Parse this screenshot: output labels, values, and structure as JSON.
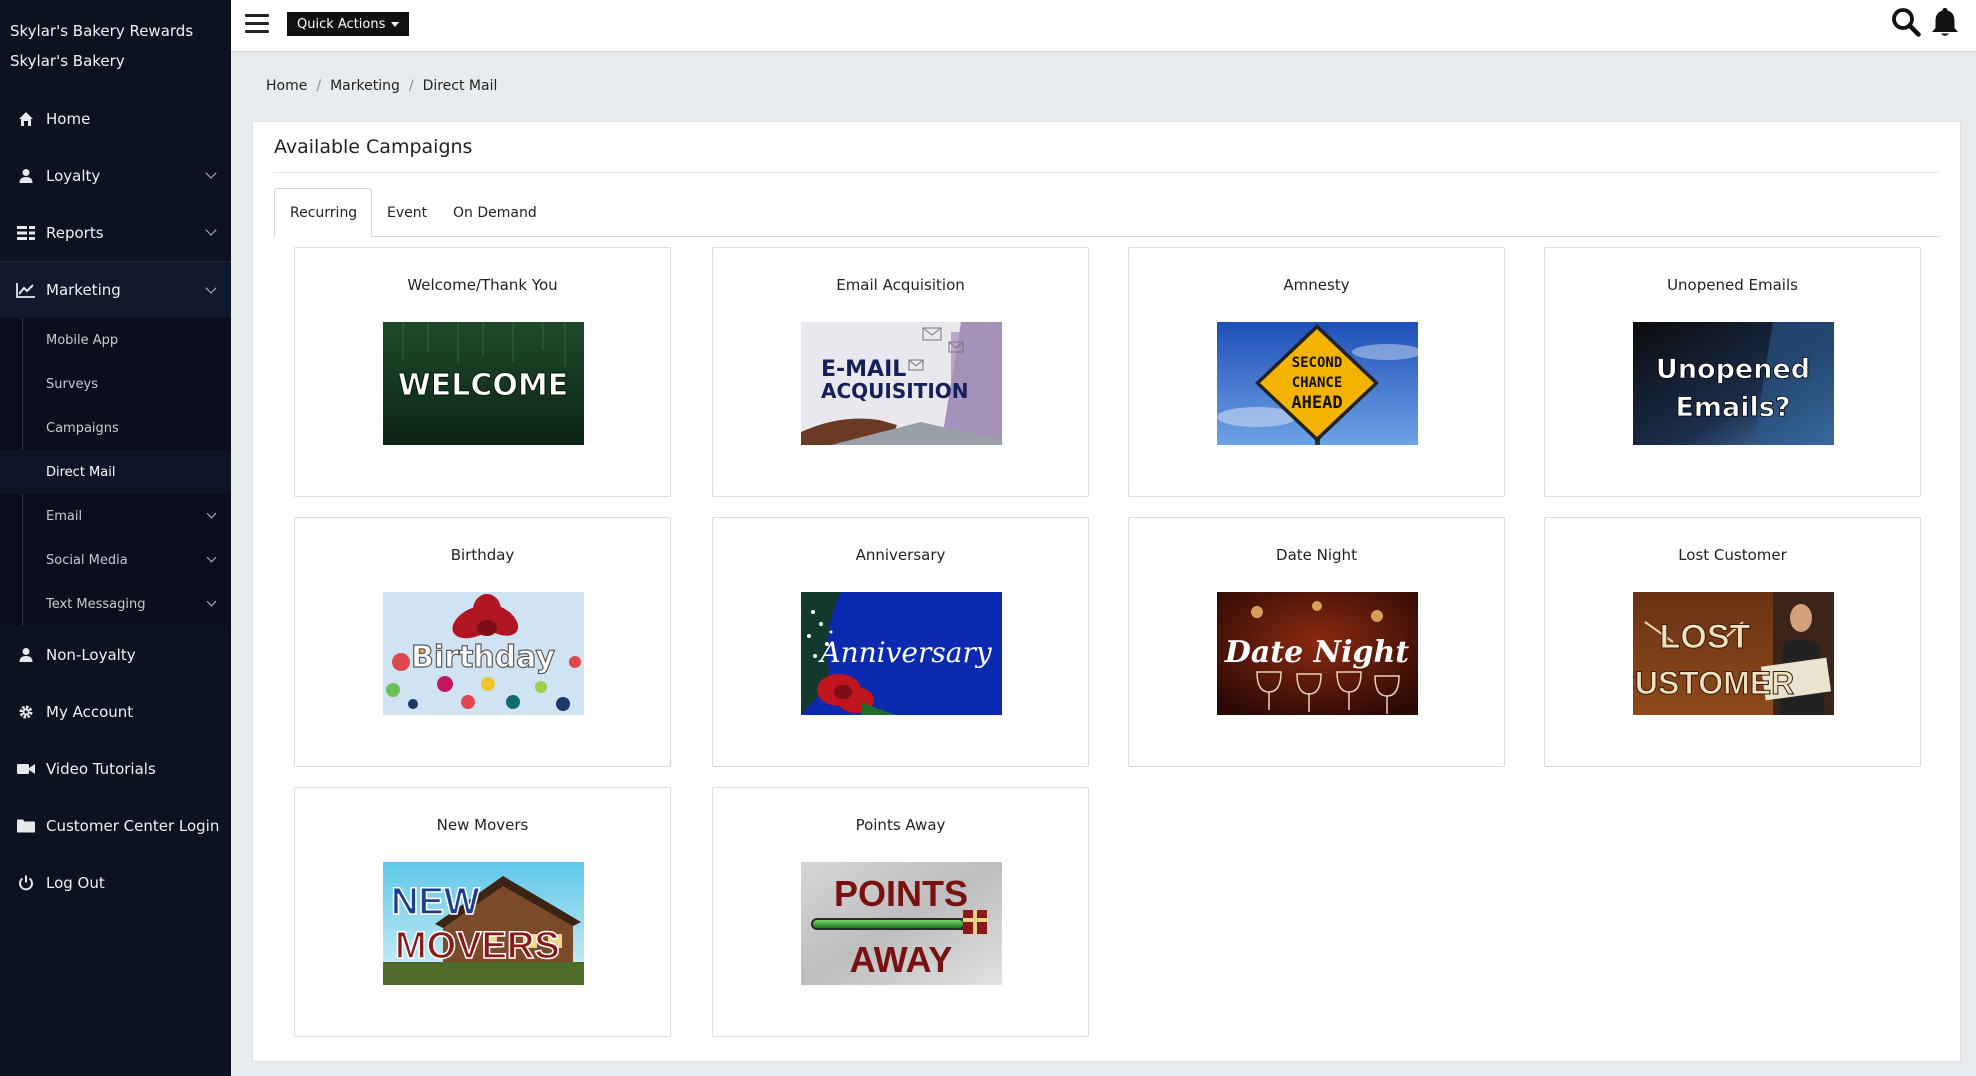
{
  "brand": {
    "program": "Skylar's Bakery Rewards",
    "business": "Skylar's Bakery"
  },
  "topbar": {
    "quick_actions_label": "Quick Actions"
  },
  "sidebar": {
    "items": [
      {
        "label": "Home",
        "icon": "home-icon"
      },
      {
        "label": "Loyalty",
        "icon": "user-icon"
      },
      {
        "label": "Reports",
        "icon": "reports-icon"
      },
      {
        "label": "Marketing",
        "icon": "chart-icon"
      },
      {
        "label": "Non-Loyalty",
        "icon": "user-icon"
      },
      {
        "label": "My Account",
        "icon": "gear-icon"
      },
      {
        "label": "Video Tutorials",
        "icon": "video-icon"
      },
      {
        "label": "Customer Center Login",
        "icon": "folder-icon"
      },
      {
        "label": "Log Out",
        "icon": "power-icon"
      }
    ],
    "marketing_sub": [
      "Mobile App",
      "Surveys",
      "Campaigns",
      "Direct Mail",
      "Email",
      "Social Media",
      "Text Messaging"
    ],
    "active_sub": "Direct Mail"
  },
  "breadcrumb": [
    "Home",
    "Marketing",
    "Direct Mail"
  ],
  "panel": {
    "title": "Available Campaigns"
  },
  "tabs": [
    "Recurring",
    "Event",
    "On Demand"
  ],
  "active_tab": "Recurring",
  "campaigns": [
    {
      "title": "Welcome/Thank You",
      "image_text": [
        "WELCOME"
      ]
    },
    {
      "title": "Email Acquisition",
      "image_text": [
        "E-MAIL",
        "ACQUISITION"
      ]
    },
    {
      "title": "Amnesty",
      "image_text": [
        "SECOND",
        "CHANCE",
        "AHEAD"
      ]
    },
    {
      "title": "Unopened Emails",
      "image_text": [
        "Unopened",
        "Emails?"
      ]
    },
    {
      "title": "Birthday",
      "image_text": [
        "Birthday"
      ]
    },
    {
      "title": "Anniversary",
      "image_text": [
        "Anniversary"
      ]
    },
    {
      "title": "Date Night",
      "image_text": [
        "Date Night"
      ]
    },
    {
      "title": "Lost Customer",
      "image_text": [
        "LOST",
        "CUSTOMER"
      ]
    },
    {
      "title": "New Movers",
      "image_text": [
        "NEW",
        "MOVERS"
      ]
    },
    {
      "title": "Points Away",
      "image_text": [
        "POINTS",
        "AWAY"
      ]
    }
  ],
  "colors": {
    "sidebar_bg": "#0c1220",
    "accent_dark": "#111111",
    "page_bg": "#e9ecef"
  }
}
